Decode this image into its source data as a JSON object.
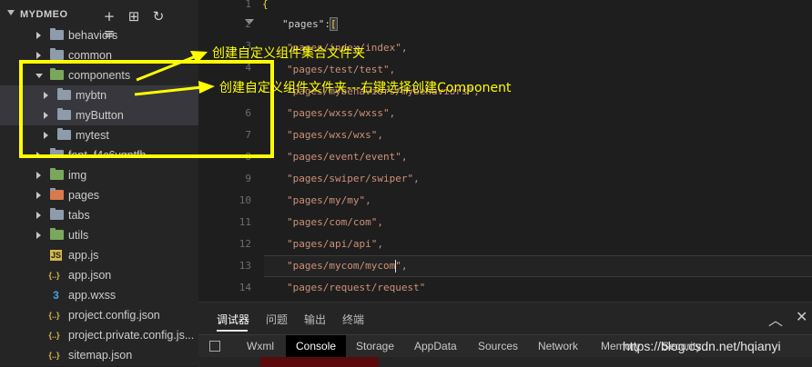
{
  "sidebar": {
    "title": "MYDMEO",
    "icons": [
      {
        "name": "new-file-icon",
        "glyph": "+"
      },
      {
        "name": "new-folder-icon",
        "glyph": "⊞"
      },
      {
        "name": "refresh-icon",
        "glyph": "↻"
      },
      {
        "name": "collapse-all-icon",
        "glyph": "≡"
      }
    ],
    "items": [
      {
        "label": "behaviors",
        "kind": "folder"
      },
      {
        "label": "common",
        "kind": "folder"
      },
      {
        "label": "components",
        "kind": "folder-green"
      },
      {
        "label": "mybtn",
        "kind": "folder"
      },
      {
        "label": "myButton",
        "kind": "folder"
      },
      {
        "label": "mytest",
        "kind": "folder"
      },
      {
        "label": "font_f4c6vqntfh",
        "kind": "folder"
      },
      {
        "label": "img",
        "kind": "folder-green"
      },
      {
        "label": "pages",
        "kind": "folder"
      },
      {
        "label": "tabs",
        "kind": "folder"
      },
      {
        "label": "utils",
        "kind": "folder-green"
      },
      {
        "label": "app.js",
        "kind": "js"
      },
      {
        "label": "app.json",
        "kind": "json"
      },
      {
        "label": "app.wxss",
        "kind": "wxss"
      },
      {
        "label": "project.config.json",
        "kind": "json"
      },
      {
        "label": "project.private.config.js...",
        "kind": "json"
      },
      {
        "label": "sitemap.json",
        "kind": "json"
      }
    ]
  },
  "editor": {
    "line_numbers": [
      "1",
      "2",
      "3",
      "4",
      "5",
      "6",
      "7",
      "8",
      "9",
      "10",
      "11",
      "12",
      "13",
      "14"
    ],
    "line1": "{",
    "line2_key": "\"pages\"",
    "line2_colon": ":",
    "line2_bracket": "[",
    "line3": "\"pages/index/index\",",
    "line4": "\"pages/test/test\",",
    "line5": "\"pages/mybehaviors/mybehaviors\",",
    "line6": "\"pages/wxss/wxss\",",
    "line7": "\"pages/wxs/wxs\",",
    "line8": "\"pages/event/event\",",
    "line9": "\"pages/swiper/swiper\",",
    "line10": "\"pages/my/my\",",
    "line11": "\"pages/com/com\",",
    "line12": "\"pages/api/api\",",
    "line13": "\"pages/mycom/mycom\",",
    "line14": "\"pages/request/request\""
  },
  "panel": {
    "tabs": [
      "调试器",
      "问题",
      "输出",
      "终端"
    ],
    "devtools_tabs": [
      "Wxml",
      "Console",
      "Storage",
      "AppData",
      "Sources",
      "Network",
      "Memory",
      "Security"
    ]
  },
  "annotations": {
    "note1": "创建自定义组件集合文件夹",
    "note2": "创建自定义组件文件夹---右键选择创建Component",
    "color": "#ffff00"
  },
  "watermark": "https://blog.csdn.net/hqianyi"
}
